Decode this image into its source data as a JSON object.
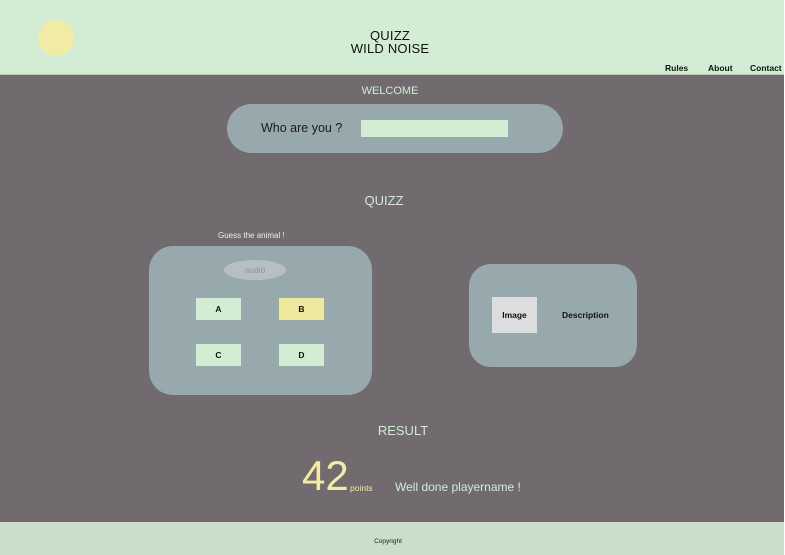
{
  "header": {
    "title_line1": "QUIZZ",
    "title_line2": "WILD NOISE",
    "nav": [
      "Rules",
      "About",
      "Contact"
    ]
  },
  "welcome": {
    "heading": "WELCOME",
    "prompt": "Who are you ?",
    "name_value": ""
  },
  "quiz": {
    "heading": "QUIZZ",
    "instruction": "Guess the animal !",
    "audio_label": "audio",
    "answers": [
      "A",
      "B",
      "C",
      "D"
    ],
    "selected_answer": "B",
    "image_label": "Image",
    "description_label": "Description"
  },
  "result": {
    "heading": "RESULT",
    "score": "42",
    "points_label": "points",
    "message": "Well done playername !"
  },
  "footer": {
    "copyright": "Copyright"
  },
  "colors": {
    "header_bg": "#d3ecd4",
    "main_bg": "#716b6f",
    "card_bg": "#98a9ad",
    "accent_yellow": "#f2eba5",
    "selected_answer": "#eee99c"
  }
}
